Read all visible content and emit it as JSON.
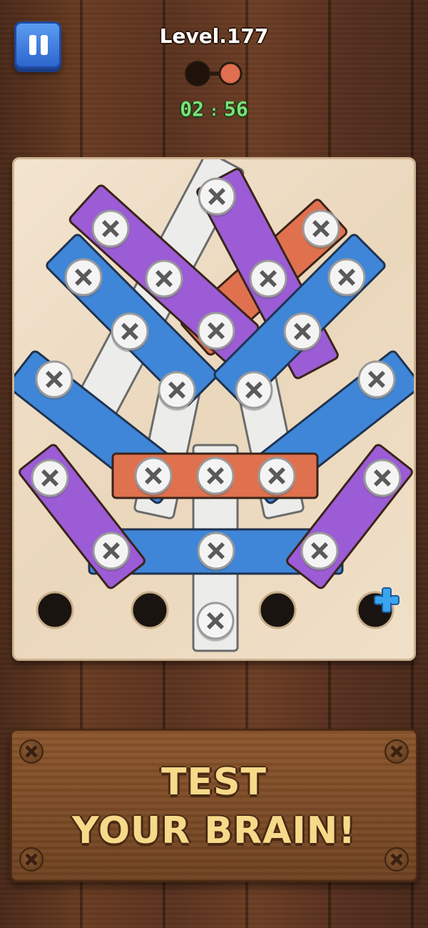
{
  "hud": {
    "level_label": "Level.177",
    "timer_minutes": "02",
    "timer_separator": ":",
    "timer_seconds": "56",
    "progress_filled": 1,
    "progress_total": 2
  },
  "board": {
    "empty_holes": 4,
    "add_hole_icon": "plus-icon",
    "planks": [
      {
        "color": "white",
        "screws": 1
      },
      {
        "color": "white",
        "screws": 1
      },
      {
        "color": "white",
        "screws": 2
      },
      {
        "color": "red",
        "screws": 2
      },
      {
        "color": "purple",
        "screws": 3
      },
      {
        "color": "purple",
        "screws": 3
      },
      {
        "color": "blue",
        "screws": 3
      },
      {
        "color": "blue",
        "screws": 3
      },
      {
        "color": "blue",
        "screws": 2
      },
      {
        "color": "blue",
        "screws": 2
      },
      {
        "color": "red",
        "screws": 3
      },
      {
        "color": "blue",
        "screws": 1
      },
      {
        "color": "purple",
        "screws": 2
      },
      {
        "color": "purple",
        "screws": 2
      }
    ]
  },
  "colors": {
    "blue": "#3f86d8",
    "purple": "#9b5cd6",
    "red": "#e0714f",
    "white": "#ececea",
    "timer": "#7be07b",
    "sign_text": "#f7d98a"
  },
  "banner": {
    "line1": "TEST",
    "line2": "YOUR BRAIN!"
  }
}
